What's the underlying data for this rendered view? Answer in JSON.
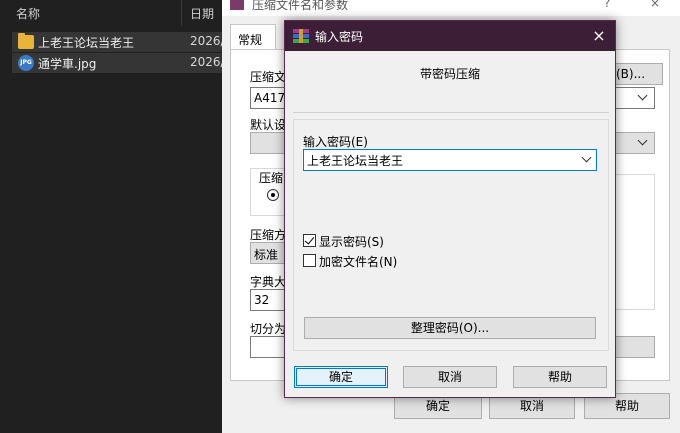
{
  "explorer": {
    "columns": {
      "name": "名称",
      "date": "日期"
    },
    "files": [
      {
        "name": "上老王论坛当老王",
        "date": "2026/",
        "icon": "folder-icon"
      },
      {
        "name": "通学車.jpg",
        "date": "2026/",
        "icon": "jpg-file-icon",
        "icon_text": "JPG"
      }
    ]
  },
  "archive_dialog": {
    "title": "压缩文件名和参数",
    "title_help": "?",
    "title_close": "×",
    "tab": "常规",
    "labels": {
      "archive_name": "压缩文",
      "archive_name_value": "A4177",
      "default_settings": "默认设",
      "format": "压缩",
      "compression": "压缩方",
      "compression_value": "标准",
      "dict": "字典大",
      "dict_value": "32",
      "split": "切分为"
    },
    "browse_button": "(B)...",
    "buttons": {
      "ok": "确定",
      "cancel": "取消",
      "help": "帮助"
    }
  },
  "password_dialog": {
    "title": "输入密码",
    "close": "×",
    "heading": "带密码压缩",
    "enter_password_label": "输入密码(E)",
    "password_value": "上老王论坛当老王",
    "show_password": {
      "label": "显示密码(S)",
      "checked": true
    },
    "encrypt_filenames": {
      "label": "加密文件名(N)",
      "checked": false
    },
    "organize_button": "整理密码(O)...",
    "buttons": {
      "ok": "确定",
      "cancel": "取消",
      "help": "帮助"
    }
  },
  "colors": {
    "explorer_bg": "#202020",
    "dialog_title_bg": "#3c1f36",
    "accent": "#0078d7",
    "dialog_bg": "#f0f0f0"
  }
}
